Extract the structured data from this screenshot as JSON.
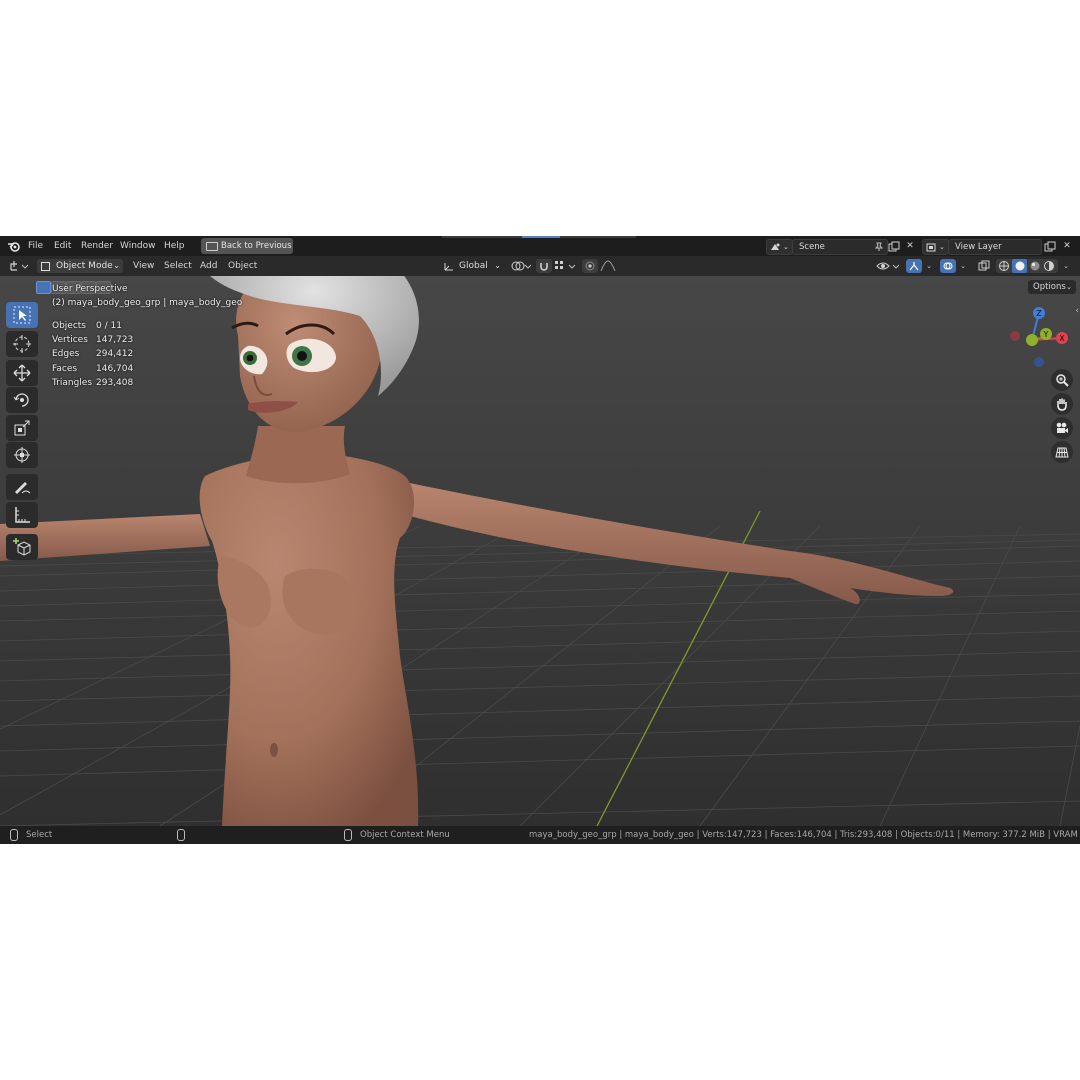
{
  "menubar": {
    "items": [
      "File",
      "Edit",
      "Render",
      "Window",
      "Help"
    ],
    "back_button": "Back to Previous",
    "scene_label": "Scene",
    "view_layer_label": "View Layer"
  },
  "header": {
    "mode": "Object Mode",
    "menus": [
      "View",
      "Select",
      "Add",
      "Object"
    ],
    "orientation": "Global"
  },
  "viewport": {
    "view_name": "User Perspective",
    "object_path": "(2) maya_body_geo_grp | maya_body_geo",
    "stats": [
      {
        "label": "Objects",
        "value": "0 / 11"
      },
      {
        "label": "Vertices",
        "value": "147,723"
      },
      {
        "label": "Edges",
        "value": "294,412"
      },
      {
        "label": "Faces",
        "value": "146,704"
      },
      {
        "label": "Triangles",
        "value": "293,408"
      }
    ],
    "options_label": "Options",
    "gizmo": {
      "z": "Z",
      "y": "Y",
      "x": "X"
    }
  },
  "statusbar": {
    "left_action": "Select",
    "middle_action": "Object Context Menu",
    "info": "maya_body_geo_grp | maya_body_geo | Verts:147,723 | Faces:146,704 | Tris:293,408 | Objects:0/11 | Memory: 377.2 MiB | VRAM: 0.6/2.0"
  },
  "colors": {
    "accent": "#4772b3",
    "skin": "#a8765e",
    "hair": "#c9c9c9",
    "axis_x": "#e0424f",
    "axis_y": "#7ea21f",
    "axis_z": "#3f7fd8"
  },
  "icons": [
    "blender-logo",
    "scene-icon",
    "view-layer-icon",
    "cursor-icon",
    "move-icon",
    "rotate-icon",
    "scale-icon",
    "transform-icon",
    "annotate-icon",
    "measure-icon",
    "add-cube-icon",
    "zoom-icon",
    "hand-icon",
    "camera-icon",
    "grid-icon"
  ]
}
